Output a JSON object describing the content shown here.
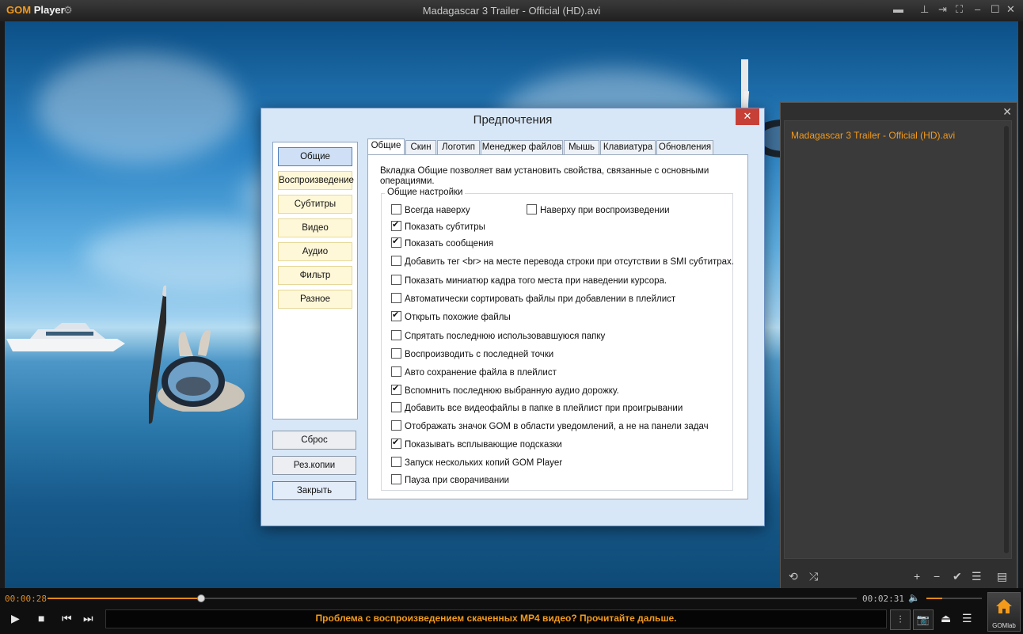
{
  "app": {
    "logo_gom": "GOM",
    "logo_player": "Player",
    "window_title": "Madagascar 3 Trailer - Official (HD).avi"
  },
  "dialog": {
    "title": "Предпочтения",
    "nav": [
      "Общие",
      "Воспроизведение",
      "Субтитры",
      "Видео",
      "Аудио",
      "Фильтр",
      "Разное"
    ],
    "buttons": {
      "reset": "Сброс",
      "backup": "Рез.копии",
      "close": "Закрыть"
    },
    "tabs": [
      "Общие",
      "Скин",
      "Логотип",
      "Менеджер файлов",
      "Мышь",
      "Клавиатура",
      "Обновления"
    ],
    "description": "Вкладка Общие позволяет вам установить свойства, связанные с основными операциями.",
    "group_title": "Общие настройки",
    "options": [
      {
        "label": "Всегда наверху",
        "checked": false
      },
      {
        "label": "Наверху при воспроизведении",
        "checked": false
      },
      {
        "label": "Показать субтитры",
        "checked": true
      },
      {
        "label": "Показать сообщения",
        "checked": true
      },
      {
        "label": "Добавить тег <br> на месте перевода строки при отсутствии в SMI субтитрах.",
        "checked": false
      },
      {
        "label": "Показать миниатюр кадра того места при наведении курсора.",
        "checked": false
      },
      {
        "label": "Автоматически сортировать файлы при добавлении в плейлист",
        "checked": false
      },
      {
        "label": "Открыть похожие файлы",
        "checked": true
      },
      {
        "label": "Спрятать последнюю использовавшуюся папку",
        "checked": false
      },
      {
        "label": "Воспроизводить с последней точки",
        "checked": false
      },
      {
        "label": "Авто сохранение файла в плейлист",
        "checked": false
      },
      {
        "label": "Вспомнить последнюю выбранную аудио дорожку.",
        "checked": true
      },
      {
        "label": "Добавить все видеофайлы в папке в плейлист при проигрывании",
        "checked": false
      },
      {
        "label": "Отображать значок GOM в области уведомлений, а не на панели задач",
        "checked": false
      },
      {
        "label": "Показывать всплывающие подсказки",
        "checked": true
      },
      {
        "label": "Запуск нескольких копий GOM Player",
        "checked": false
      },
      {
        "label": "Пауза при сворачивании",
        "checked": false
      }
    ]
  },
  "playlist": {
    "items": [
      "Madagascar 3 Trailer - Official (HD).avi"
    ]
  },
  "player": {
    "time_current": "00:00:28",
    "time_total": "00:02:31",
    "progress_fraction": 0.189,
    "volume_fraction": 0.28,
    "ticker": "Проблема с воспроизведением скаченных MP4 видео? Прочитайте дальше.",
    "home_label": "GOMlab"
  },
  "colors": {
    "accent": "#f39a1b",
    "dialog_bg": "#d8e7f7",
    "close_red": "#c74037"
  }
}
